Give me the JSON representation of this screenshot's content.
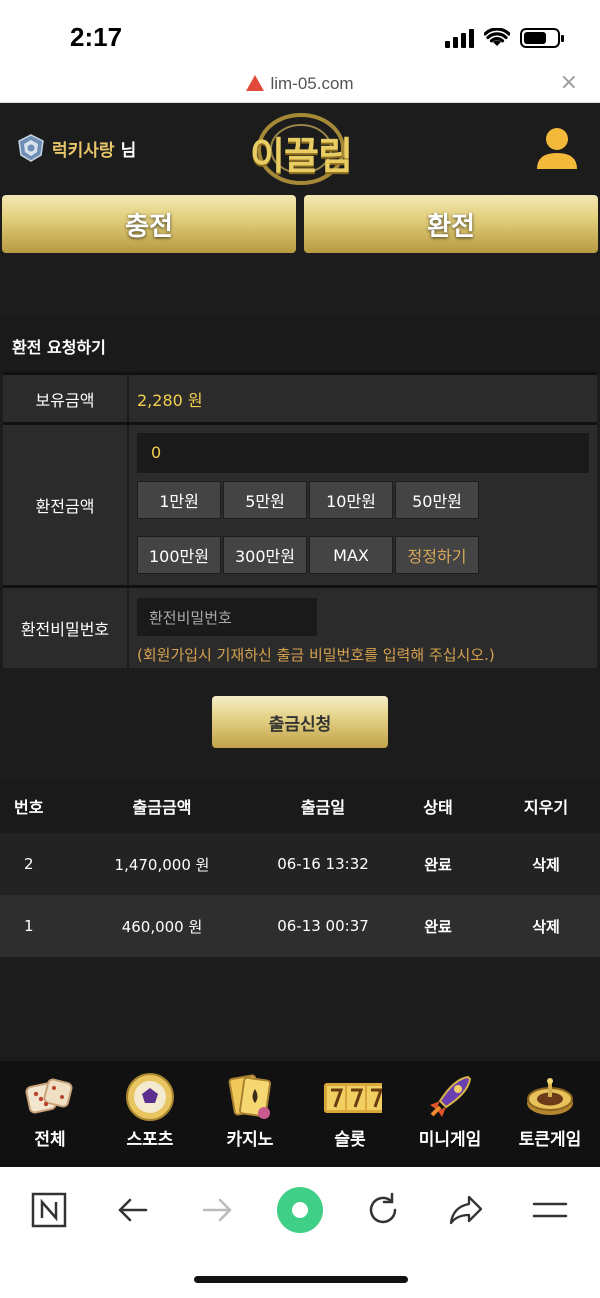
{
  "status_bar": {
    "time": "2:17"
  },
  "browser": {
    "url": "lim-05.com",
    "close_glyph": "×"
  },
  "header": {
    "username": "럭키사랑",
    "honorific": "님",
    "logo_text": "이끌림"
  },
  "tabs": {
    "deposit": "충전",
    "withdraw": "환전"
  },
  "form": {
    "title": "환전 요청하기",
    "balance_label": "보유금액",
    "balance_value": "2,280 원",
    "amount_label": "환전금액",
    "amount_value": "0",
    "chips": [
      "1만원",
      "5만원",
      "10만원",
      "50만원",
      "100만원",
      "300만원",
      "MAX",
      "정정하기"
    ],
    "password_label": "환전비밀번호",
    "password_placeholder": "환전비밀번호",
    "password_hint": "(회원가입시 기재하신 출금 비밀번호를 입력해 주십시오.)",
    "submit_label": "출금신청"
  },
  "history": {
    "columns": [
      "번호",
      "출금금액",
      "출금일",
      "상태",
      "지우기"
    ],
    "rows": [
      {
        "no": "2",
        "amount": "1,470,000 원",
        "date": "06-16 13:32",
        "status": "완료",
        "delete": "삭제"
      },
      {
        "no": "1",
        "amount": "460,000 원",
        "date": "06-13 00:37",
        "status": "완료",
        "delete": "삭제"
      }
    ]
  },
  "game_nav": [
    {
      "label": "전체",
      "icon": "dice-icon"
    },
    {
      "label": "스포츠",
      "icon": "soccer-ball-icon"
    },
    {
      "label": "카지노",
      "icon": "playing-cards-icon"
    },
    {
      "label": "슬롯",
      "icon": "slot-777-icon"
    },
    {
      "label": "미니게임",
      "icon": "rocket-icon"
    },
    {
      "label": "토큰게임",
      "icon": "roulette-icon"
    }
  ],
  "colors": {
    "gold": "#e2cf7c",
    "accent_yellow": "#f2d04f",
    "hint_orange": "#d6a24f",
    "background": "#1c1c1c"
  }
}
